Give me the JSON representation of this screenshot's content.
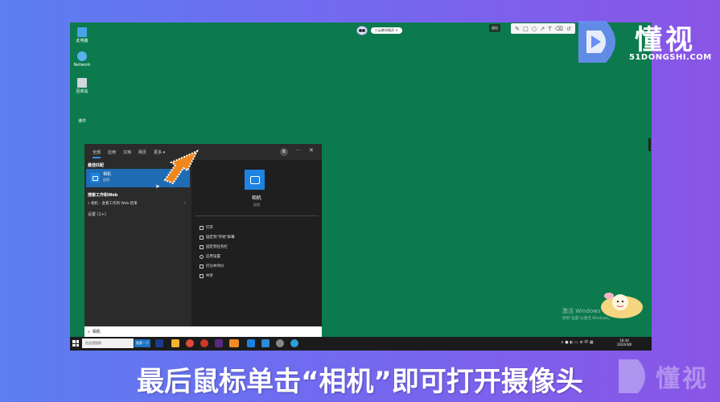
{
  "desktop": {
    "icons": [
      {
        "label": "此电脑",
        "icon": "computer-icon"
      },
      {
        "label": "Network",
        "icon": "network-icon"
      },
      {
        "label": "回收站",
        "icon": "recycle-bin-icon"
      },
      {
        "label": "课件",
        "icon": "folder-icon"
      }
    ]
  },
  "top": {
    "pill": "小云教学精灵",
    "exit": "退出"
  },
  "start_menu": {
    "tabs": [
      "全部",
      "应用",
      "文档",
      "网页",
      "更多 ▾"
    ],
    "avatar": "B",
    "more": "···",
    "close": "✕",
    "best_match_header": "最佳匹配",
    "best_match_name": "相机",
    "best_match_type": "应用",
    "web_header": "搜索工作和Web",
    "web_item": "相机 - 查看工作和 Web 结果",
    "settings_header": "设置 (1+)",
    "preview_name": "相机",
    "preview_type": "应用",
    "actions": [
      "打开",
      "固定到\"开始\"屏幕",
      "固定到任务栏",
      "应用设置",
      "打分并评价",
      "共享"
    ]
  },
  "search": {
    "value": "相机"
  },
  "taskbar": {
    "search_placeholder": "在这里搜索",
    "search_button": "搜索一下",
    "time": "16:34",
    "date": "2022/4/8"
  },
  "watermark": {
    "activate_title": "激活 Windows",
    "activate_sub": "转到\"设置\"以激活 Windows。",
    "brand": "懂视",
    "brand_url": "51DONGSHI.COM"
  },
  "caption": "最后鼠标单击“相机”即可打开摄像头",
  "colors": {
    "accent": "#1f6cb5",
    "desktop": "#0c7a4d",
    "arrow": "#f0871e"
  }
}
